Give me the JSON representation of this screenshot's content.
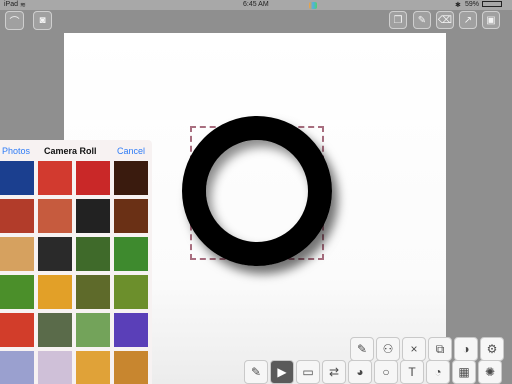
{
  "status": {
    "device": "iPad",
    "time": "6:45 AM",
    "battery": "59%"
  },
  "icons": {
    "brush_select": "brush-select-icon",
    "camera": "camera-icon",
    "stack": "stack-icon",
    "settings_brush": "brush-settings-icon",
    "clear": "clear-icon",
    "share": "share-icon",
    "save": "save-icon"
  },
  "photo_picker": {
    "back_label": "Photos",
    "title": "Camera Roll",
    "cancel_label": "Cancel",
    "thumbnails": [
      [
        "#1b3f8f",
        "#d23a2f",
        "#c92828",
        "#3a1b0e"
      ],
      [
        "#b23c2a",
        "#c65b3e",
        "#222222",
        "#6a3015"
      ],
      [
        "#d6a15f",
        "#2a2a2a",
        "#3f6a2a",
        "#3e8a2e"
      ],
      [
        "#4b8f2a",
        "#e2a028",
        "#5e6a2a",
        "#6c8f2c"
      ],
      [
        "#d23d2a",
        "#5a6b4a",
        "#73a35a",
        "#5a3fb8"
      ],
      [
        "#9aa0cf",
        "#cfc0d8",
        "#e0a238",
        "#c8862f"
      ]
    ]
  },
  "tools_row1": [
    "pencil-icon",
    "stamp-icon",
    "close-icon",
    "resize-icon",
    "mask-icon",
    "gear-icon"
  ],
  "tools_row2": [
    "pencil-icon",
    "play-icon",
    "eraser-icon",
    "replace-icon",
    "palette-icon",
    "circle-icon",
    "text-icon",
    "shape-icon",
    "layout-icon",
    "effects-icon"
  ],
  "colors": {
    "accent_blue": "#2f7cf6",
    "selection": "#a86e7f"
  }
}
